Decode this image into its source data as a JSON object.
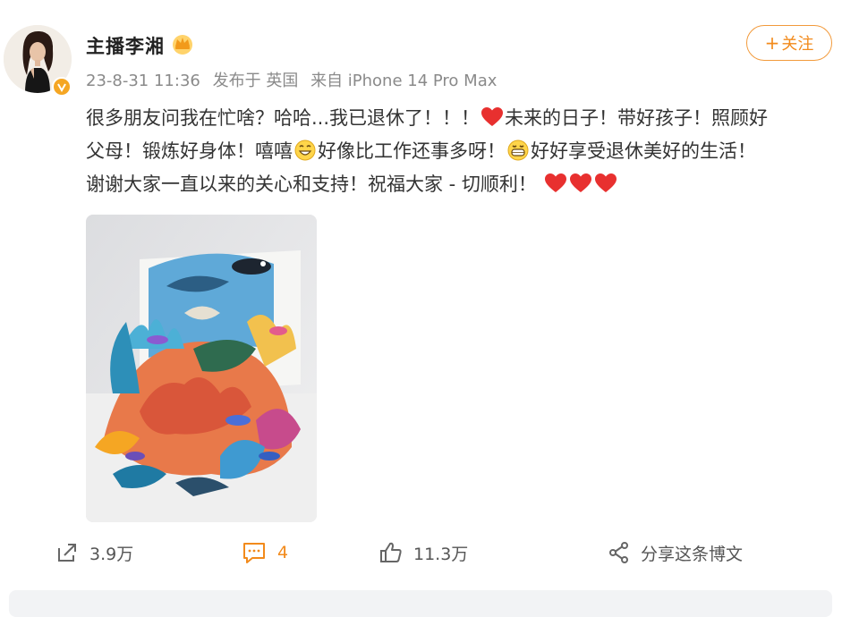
{
  "post": {
    "author": {
      "name": "主播李湘",
      "verified": true,
      "badge_color": "#f5a623"
    },
    "meta": {
      "date": "23-8-31 11:36",
      "location": "发布于 英国",
      "device": "来自 iPhone 14 Pro Max"
    },
    "follow": {
      "plus": "+",
      "label": "关注"
    },
    "content": {
      "line1_a": "很多朋友问我在忙啥？哈哈...我已退休了！！！",
      "line1_b": "未来的日子！带好孩子！照顾好",
      "line2_a": "父母！锻炼好身体！嘻嘻",
      "line2_b": "好像比工作还事多呀！",
      "line2_c": "好好享受退休美好的生活！",
      "line3_a": "谢谢大家一直以来的关心和支持！祝福大家 - 切顺利！",
      "icons": [
        "heart-icon",
        "grin-emoji-icon",
        "grin-big-emoji-icon"
      ]
    },
    "actions": {
      "repost_count": "3.9万",
      "comment_count": "4",
      "like_count": "11.3万",
      "share_label": "分享这条博文"
    },
    "colors": {
      "accent": "#f28a1b",
      "heart": "#e8302f",
      "meta_text": "#8a8a8a"
    }
  }
}
